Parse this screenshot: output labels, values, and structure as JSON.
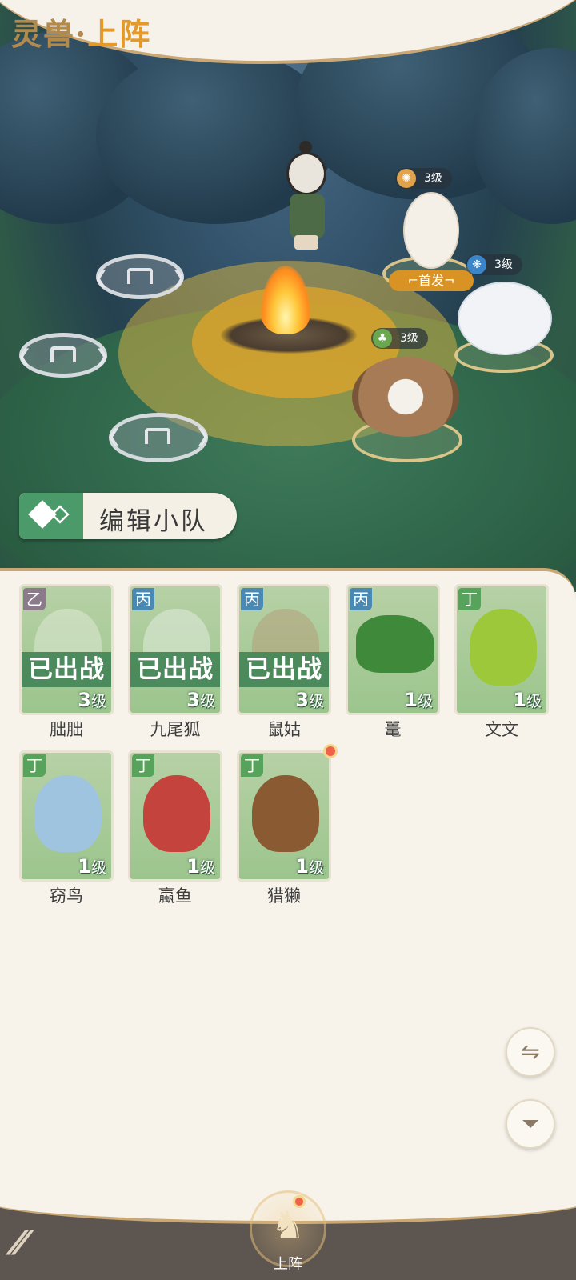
{
  "header": {
    "title_part1": "灵兽·",
    "title_part2": "上阵"
  },
  "scene": {
    "pets": [
      {
        "level": "3级",
        "element_color": "#e0a24a"
      },
      {
        "level": "3级",
        "element_color": "#3a86c8"
      },
      {
        "level": "3级",
        "element_color": "#6aa84f"
      }
    ],
    "first_badge": "首发"
  },
  "edit_team": {
    "label": "编辑小队"
  },
  "roster": [
    {
      "name": "朏朏",
      "grade": "乙",
      "grade_color": "#8a7a8a",
      "level_num": "3",
      "level_unit": "级",
      "deployed": "已出战",
      "color": "#e9efe0"
    },
    {
      "name": "九尾狐",
      "grade": "丙",
      "grade_color": "#4a89b4",
      "level_num": "3",
      "level_unit": "级",
      "deployed": "已出战",
      "color": "#eef1ea"
    },
    {
      "name": "鼠姑",
      "grade": "丙",
      "grade_color": "#4a89b4",
      "level_num": "3",
      "level_unit": "级",
      "deployed": "已出战",
      "color": "#b59470"
    },
    {
      "name": "鼍",
      "grade": "丙",
      "grade_color": "#4a89b4",
      "level_num": "1",
      "level_unit": "级",
      "deployed": "",
      "color": "#3f8a3a"
    },
    {
      "name": "文文",
      "grade": "丁",
      "grade_color": "#58a35c",
      "level_num": "1",
      "level_unit": "级",
      "deployed": "",
      "color": "#9cc83a"
    },
    {
      "name": "窃鸟",
      "grade": "丁",
      "grade_color": "#58a35c",
      "level_num": "1",
      "level_unit": "级",
      "deployed": "",
      "color": "#9fc4e0"
    },
    {
      "name": "蠃鱼",
      "grade": "丁",
      "grade_color": "#58a35c",
      "level_num": "1",
      "level_unit": "级",
      "deployed": "",
      "color": "#c5433d"
    },
    {
      "name": "猎獭",
      "grade": "丁",
      "grade_color": "#58a35c",
      "level_num": "1",
      "level_unit": "级",
      "deployed": "",
      "color": "#8a5a33"
    }
  ],
  "buttons": {
    "swap_icon": "⇋",
    "filter_icon": "⏷"
  },
  "bottom_nav": {
    "logo": "⁄⁄",
    "deploy_label": "上阵",
    "deploy_icon": "♞"
  }
}
